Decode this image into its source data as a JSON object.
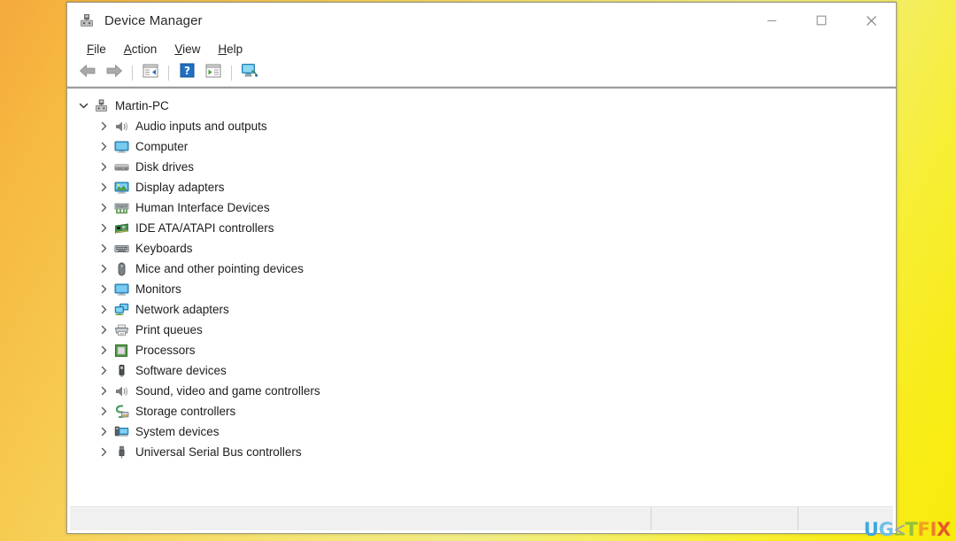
{
  "window": {
    "title": "Device Manager",
    "title_icon": "device-manager-icon",
    "controls": {
      "minimize": "minimize-button",
      "maximize": "maximize-button",
      "close": "close-button"
    }
  },
  "menubar": {
    "items": [
      {
        "label": "File",
        "accel": "F",
        "rest": "ile"
      },
      {
        "label": "Action",
        "accel": "A",
        "rest": "ction"
      },
      {
        "label": "View",
        "accel": "V",
        "rest": "iew"
      },
      {
        "label": "Help",
        "accel": "H",
        "rest": "elp"
      }
    ]
  },
  "toolbar": {
    "buttons": [
      {
        "name": "back-icon",
        "label": "Back"
      },
      {
        "name": "forward-icon",
        "label": "Forward"
      },
      {
        "name": "show-hide-tree-icon",
        "label": "Show/Hide console tree"
      },
      {
        "name": "help-icon",
        "label": "Help"
      },
      {
        "name": "properties-icon",
        "label": "Properties"
      },
      {
        "name": "scan-hardware-icon",
        "label": "Scan for hardware changes"
      }
    ]
  },
  "tree": {
    "root": {
      "label": "Martin-PC",
      "icon": "computer-tower-icon",
      "expanded": true,
      "chevron": "chevron-down-icon"
    },
    "items": [
      {
        "label": "Audio inputs and outputs",
        "icon": "speaker-icon"
      },
      {
        "label": "Computer",
        "icon": "monitor-icon"
      },
      {
        "label": "Disk drives",
        "icon": "disk-drive-icon"
      },
      {
        "label": "Display adapters",
        "icon": "display-adapter-icon"
      },
      {
        "label": "Human Interface Devices",
        "icon": "hid-icon"
      },
      {
        "label": "IDE ATA/ATAPI controllers",
        "icon": "ide-controller-icon"
      },
      {
        "label": "Keyboards",
        "icon": "keyboard-icon"
      },
      {
        "label": "Mice and other pointing devices",
        "icon": "mouse-icon"
      },
      {
        "label": "Monitors",
        "icon": "monitor-icon"
      },
      {
        "label": "Network adapters",
        "icon": "network-adapter-icon"
      },
      {
        "label": "Print queues",
        "icon": "printer-icon"
      },
      {
        "label": "Processors",
        "icon": "processor-icon"
      },
      {
        "label": "Software devices",
        "icon": "software-device-icon"
      },
      {
        "label": "Sound, video and game controllers",
        "icon": "sound-controller-icon"
      },
      {
        "label": "Storage controllers",
        "icon": "storage-controller-icon"
      },
      {
        "label": "System devices",
        "icon": "system-device-icon"
      },
      {
        "label": "Universal Serial Bus controllers",
        "icon": "usb-controller-icon"
      }
    ],
    "child_chevron": "chevron-right-icon"
  },
  "statusbar": {
    "left_text": "",
    "mid_text": "",
    "right_text": ""
  },
  "watermark": {
    "part_u": "U",
    "part_g": "G",
    "part_e": "E",
    "part_t": "T",
    "part_f": "F",
    "part_i": "I",
    "part_x": "X"
  }
}
